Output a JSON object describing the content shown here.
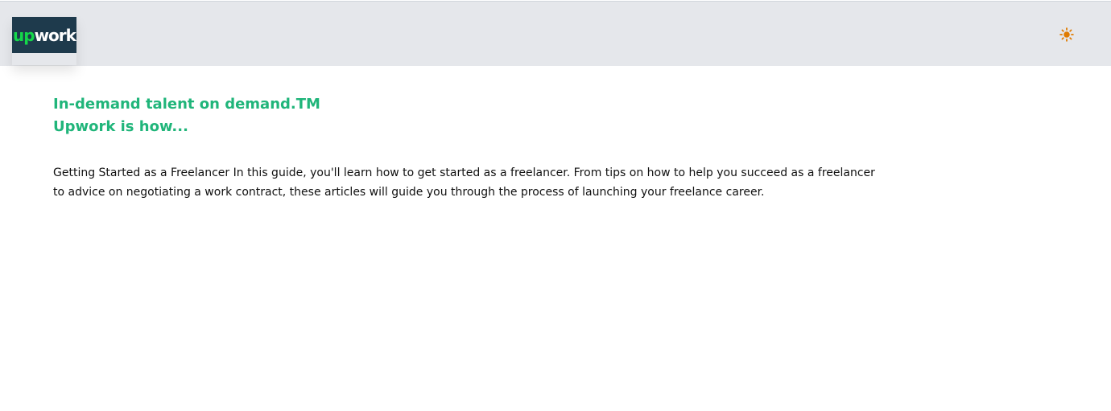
{
  "header": {
    "logo": {
      "text_up": "up",
      "text_work": "work",
      "bg_color": "#1e3a4c",
      "accent_color": "#14d84a"
    },
    "theme_toggle": {
      "icon": "sun-icon",
      "color": "#e07b00"
    }
  },
  "main": {
    "headline_line1": "In-demand talent on demand.TM",
    "headline_line2": "Upwork is how...",
    "body": "Getting Started as a Freelancer In this guide, you'll learn how to get started as a freelancer. From tips on how to help you succeed as a freelancer to advice on negotiating a work contract, these articles will guide you through the process of launching your freelance career."
  },
  "colors": {
    "header_bg": "#e5e7eb",
    "headline": "#20b57a",
    "text": "#111111"
  }
}
